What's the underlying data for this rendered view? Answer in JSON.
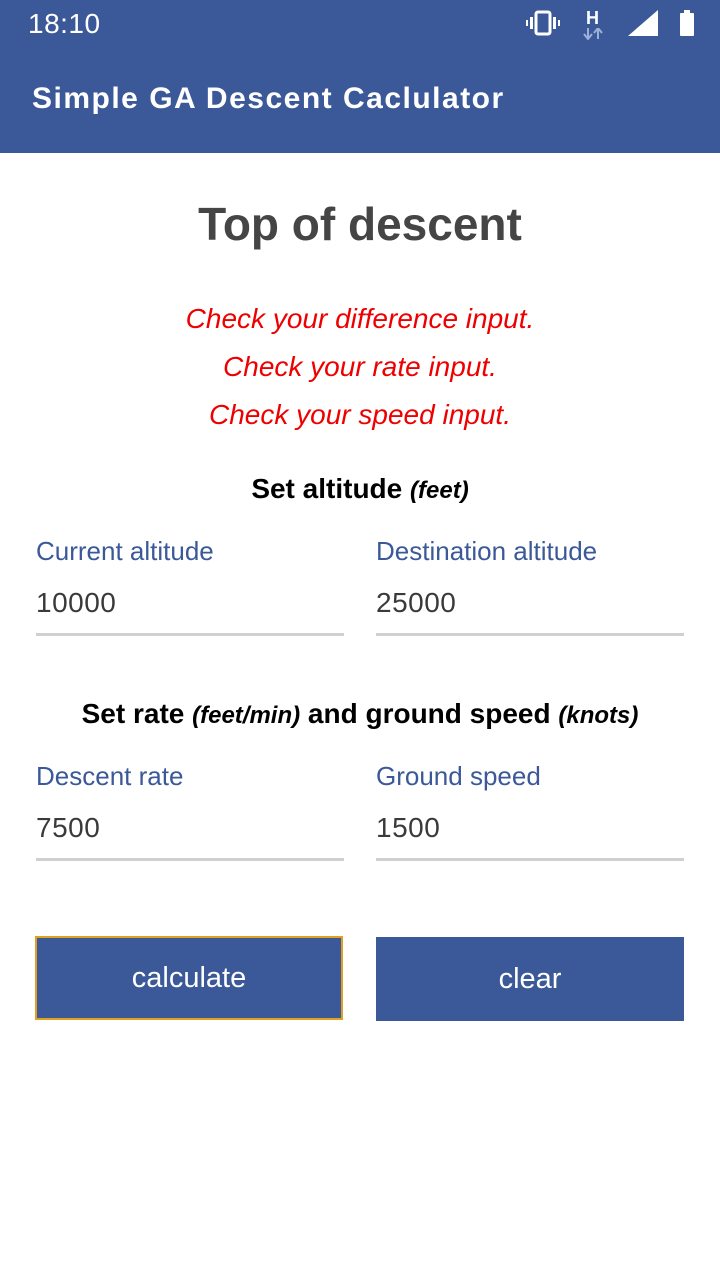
{
  "status_bar": {
    "time": "18:10",
    "icons": [
      "vibrate-icon",
      "network-h-icon",
      "signal-icon",
      "battery-icon"
    ],
    "network_label": "H"
  },
  "app_bar": {
    "title": "Simple GA Descent Caclulator"
  },
  "page": {
    "title": "Top of descent",
    "errors": [
      "Check your difference input.",
      "Check your rate input.",
      "Check your speed input."
    ]
  },
  "altitude_section": {
    "heading": "Set altitude",
    "unit": "(feet)",
    "current_altitude": {
      "label": "Current altitude",
      "value": "10000"
    },
    "destination_altitude": {
      "label": "Destination altitude",
      "value": "25000"
    }
  },
  "rate_section": {
    "heading_part1": "Set rate",
    "unit1": "(feet/min)",
    "heading_part2": "and ground speed",
    "unit2": "(knots)",
    "descent_rate": {
      "label": "Descent rate",
      "value": "7500"
    },
    "ground_speed": {
      "label": "Ground speed",
      "value": "1500"
    }
  },
  "buttons": {
    "calculate": "calculate",
    "clear": "clear"
  },
  "colors": {
    "primary": "#3b5998",
    "error": "#ee0000",
    "focus_border": "#e0a020"
  }
}
